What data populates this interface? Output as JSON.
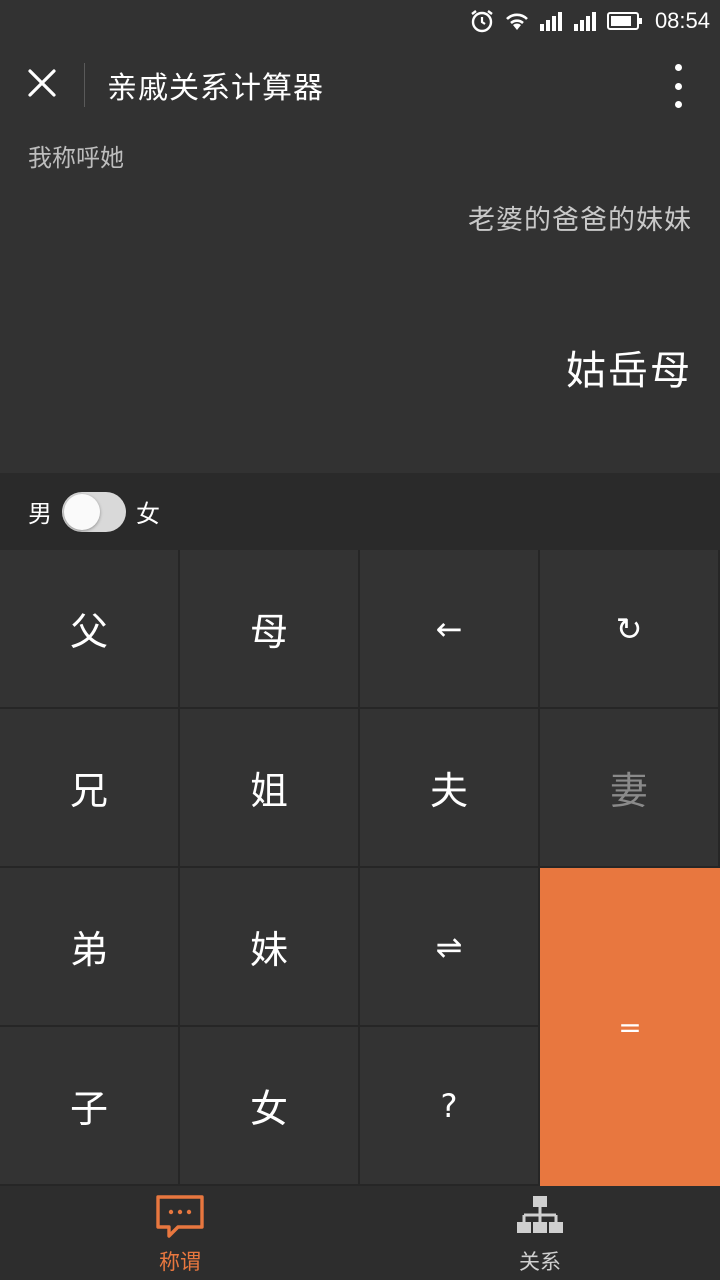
{
  "status_bar": {
    "time": "08:54",
    "icons": [
      "alarm-icon",
      "wifi-icon",
      "signal-icon",
      "signal-icon",
      "battery-icon"
    ]
  },
  "header": {
    "title": "亲戚关系计算器",
    "close_icon": "close-icon",
    "more_icon": "more-vertical-icon"
  },
  "display": {
    "prompt_label": "我称呼她",
    "expression": "老婆的爸爸的妹妹",
    "result": "姑岳母"
  },
  "gender": {
    "male_label": "男",
    "female_label": "女",
    "selected": "男"
  },
  "keypad": {
    "keys": [
      {
        "label": "父"
      },
      {
        "label": "母"
      },
      {
        "label": "←"
      },
      {
        "label": "↻"
      },
      {
        "label": "兄"
      },
      {
        "label": "姐"
      },
      {
        "label": "夫"
      },
      {
        "label": "妻"
      },
      {
        "label": "弟"
      },
      {
        "label": "妹"
      },
      {
        "label": "⇌"
      },
      {
        "label": "="
      },
      {
        "label": "子"
      },
      {
        "label": "女"
      },
      {
        "label": "?"
      }
    ],
    "accent_color": "#e8773f"
  },
  "tabs": [
    {
      "label": "称谓",
      "icon": "chat-bubble-icon",
      "active": true
    },
    {
      "label": "关系",
      "icon": "hierarchy-icon",
      "active": false
    }
  ]
}
